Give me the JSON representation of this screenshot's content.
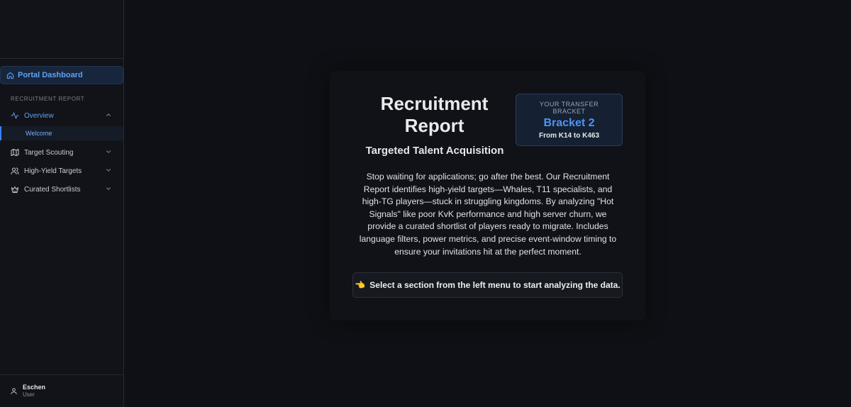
{
  "sidebar": {
    "portal_label": "Portal Dashboard",
    "section_label": "RECRUITMENT REPORT",
    "items": [
      {
        "label": "Overview",
        "icon": "activity-icon",
        "active": true,
        "expanded": true
      },
      {
        "label": "Target Scouting",
        "icon": "map-icon"
      },
      {
        "label": "High-Yield Targets",
        "icon": "users-icon"
      },
      {
        "label": "Curated Shortlists",
        "icon": "crown-icon"
      }
    ],
    "sub_item": "Welcome",
    "user": {
      "name": "Eschen",
      "role": "User"
    }
  },
  "main": {
    "title": "Recruitment Report",
    "subtitle": "Targeted Talent Acquisition",
    "bracket": {
      "label": "YOUR TRANSFER BRACKET",
      "value": "Bracket 2",
      "range": "From K14 to K463"
    },
    "description": "Stop waiting for applications; go after the best. Our Recruitment Report identifies high-yield targets—Whales, T11 specialists, and high-TG players—stuck in struggling kingdoms. By analyzing \"Hot Signals\" like poor KvK performance and high server churn, we provide a curated shortlist of players ready to migrate. Includes language filters, power metrics, and precise event-window timing to ensure your invitations hit at the perfect moment.",
    "cta": "Select a section from the left menu to start analyzing the data.",
    "cta_emoji": "👈"
  },
  "colors": {
    "accent": "#5fa1f5",
    "background": "#0e1015",
    "sidebar": "#111318"
  }
}
